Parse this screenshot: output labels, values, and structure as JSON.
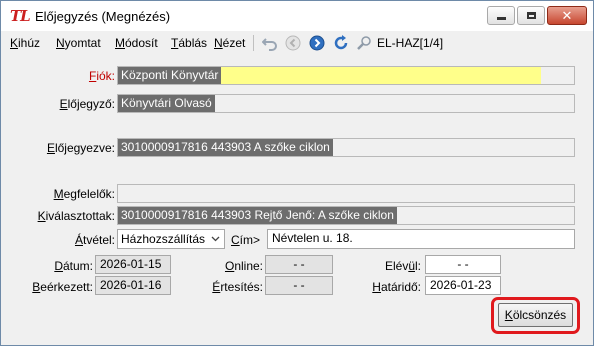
{
  "window": {
    "logo": "TL",
    "title": "Előjegyzés (Megnézés)",
    "minimize_icon": "minimize-icon",
    "maximize_icon": "maximize-icon",
    "close_icon": "close-icon",
    "close_glyph": "✕"
  },
  "menu": {
    "items": [
      {
        "underline": "K",
        "rest": "ihúz"
      },
      {
        "underline": "N",
        "rest": "yomtat"
      },
      {
        "underline": "M",
        "rest": "ódosít"
      },
      {
        "underline": "T",
        "rest": "áblás"
      },
      {
        "underline": "N",
        "rest": "ézet"
      }
    ],
    "toolbar_icons": [
      "undo-icon",
      "back-icon",
      "forward-icon",
      "refresh-icon",
      "search-icon"
    ],
    "record": "EL-HAZ[1/4]"
  },
  "form": {
    "fiok": {
      "label_u": "F",
      "label_rest": "iók:",
      "value": "Központi Könyvtár"
    },
    "elojegyzo": {
      "label_u": "E",
      "label_rest": "lőjegyző:",
      "value": "Könyvtári Olvasó"
    },
    "elojegyzve": {
      "label_u": "E",
      "label_rest": "lőjegyezve:",
      "value": "3010000917816 443903 A szőke ciklon"
    },
    "megfelelok": {
      "label_u": "M",
      "label_rest": "egfelelők:",
      "value": ""
    },
    "kivalasztottak": {
      "label_u": "K",
      "label_rest": "iválasztottak:",
      "value": "3010000917816 443903 Rejtő Jenő: A szőke ciklon"
    },
    "atvetel": {
      "label_u": "Á",
      "label_rest": "tvétel:",
      "value": "Házhozszállítás",
      "chevron": "chevron-down-icon"
    },
    "cim": {
      "label_u": "C",
      "label_rest": "ím>",
      "value": "Névtelen u. 18."
    },
    "datum": {
      "label_u": "D",
      "label_rest": "átum:",
      "value": "2026-01-15"
    },
    "online": {
      "label_u": "O",
      "label_rest": "nline:",
      "value": "-  -"
    },
    "elevul": {
      "label_pre": "Elév",
      "label_u": "ü",
      "label_rest": "l:",
      "value": "-  -"
    },
    "beerkezett": {
      "label_u": "B",
      "label_rest": "eérkezett:",
      "value": "2026-01-16"
    },
    "ertesites": {
      "label_u": "É",
      "label_rest": "rtesítés:",
      "value": "-  -"
    },
    "hatarido": {
      "label_u": "H",
      "label_rest": "atáridő:",
      "value": "2026-01-23"
    },
    "kolcsonzes_button": {
      "label_u": "K",
      "label_rest": "ölcsönzés"
    }
  }
}
